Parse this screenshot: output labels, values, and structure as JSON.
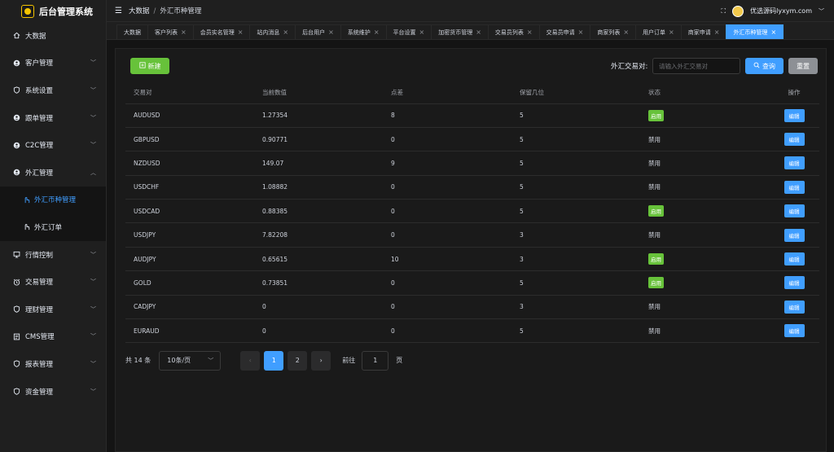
{
  "app": {
    "title": "后台管理系统"
  },
  "sidebar": {
    "items": [
      {
        "label": "大数据",
        "icon": "home-icon"
      },
      {
        "label": "客户管理",
        "icon": "user-circle-icon"
      },
      {
        "label": "系统设置",
        "icon": "shield-icon"
      },
      {
        "label": "跟单管理",
        "icon": "user-circle-icon"
      },
      {
        "label": "C2C管理",
        "icon": "user-circle-icon"
      },
      {
        "label": "外汇管理",
        "icon": "user-circle-icon"
      },
      {
        "label": "外汇币种管理",
        "icon": "pointer-icon"
      },
      {
        "label": "外汇订单",
        "icon": "pointer-icon"
      },
      {
        "label": "行情控制",
        "icon": "monitor-icon"
      },
      {
        "label": "交易管理",
        "icon": "alarm-icon"
      },
      {
        "label": "理财管理",
        "icon": "shield-icon"
      },
      {
        "label": "CMS管理",
        "icon": "document-icon"
      },
      {
        "label": "报表管理",
        "icon": "shield-icon"
      },
      {
        "label": "资金管理",
        "icon": "shield-icon"
      }
    ]
  },
  "header": {
    "breadcrumb_root": "大数据",
    "breadcrumb_current": "外汇币种管理",
    "username": "优选源码lyxym.com"
  },
  "tabs": [
    {
      "label": "大数据"
    },
    {
      "label": "客户列表"
    },
    {
      "label": "会员实名管理"
    },
    {
      "label": "站内消息"
    },
    {
      "label": "后台用户"
    },
    {
      "label": "系统维护"
    },
    {
      "label": "平台设置"
    },
    {
      "label": "加密货币管理"
    },
    {
      "label": "交易员列表"
    },
    {
      "label": "交易员申请"
    },
    {
      "label": "商家列表"
    },
    {
      "label": "用户订单"
    },
    {
      "label": "商家申请"
    },
    {
      "label": "外汇币种管理"
    }
  ],
  "toolbar": {
    "new_label": "新建",
    "filter_label": "外汇交易对:",
    "filter_placeholder": "请输入外汇交易对",
    "query_label": "查询",
    "reset_label": "重置"
  },
  "table": {
    "headers": [
      "交易对",
      "当前数值",
      "点差",
      "保留几位",
      "状态",
      "操作"
    ],
    "rows": [
      {
        "pair": "AUDUSD",
        "value": "1.27354",
        "spread": "8",
        "decimals": "5",
        "status": "启用",
        "enabled": true,
        "action": "编辑"
      },
      {
        "pair": "GBPUSD",
        "value": "0.90771",
        "spread": "0",
        "decimals": "5",
        "status": "禁用",
        "enabled": false,
        "action": "编辑"
      },
      {
        "pair": "NZDUSD",
        "value": "149.07",
        "spread": "9",
        "decimals": "5",
        "status": "禁用",
        "enabled": false,
        "action": "编辑"
      },
      {
        "pair": "USDCHF",
        "value": "1.08882",
        "spread": "0",
        "decimals": "5",
        "status": "禁用",
        "enabled": false,
        "action": "编辑"
      },
      {
        "pair": "USDCAD",
        "value": "0.88385",
        "spread": "0",
        "decimals": "5",
        "status": "启用",
        "enabled": true,
        "action": "编辑"
      },
      {
        "pair": "USDJPY",
        "value": "7.82208",
        "spread": "0",
        "decimals": "3",
        "status": "禁用",
        "enabled": false,
        "action": "编辑"
      },
      {
        "pair": "AUDJPY",
        "value": "0.65615",
        "spread": "10",
        "decimals": "3",
        "status": "启用",
        "enabled": true,
        "action": "编辑"
      },
      {
        "pair": "GOLD",
        "value": "0.73851",
        "spread": "0",
        "decimals": "5",
        "status": "启用",
        "enabled": true,
        "action": "编辑"
      },
      {
        "pair": "CADJPY",
        "value": "0",
        "spread": "0",
        "decimals": "3",
        "status": "禁用",
        "enabled": false,
        "action": "编辑"
      },
      {
        "pair": "EURAUD",
        "value": "0",
        "spread": "0",
        "decimals": "5",
        "status": "禁用",
        "enabled": false,
        "action": "编辑"
      }
    ]
  },
  "pagination": {
    "total_text": "共 14 条",
    "page_size": "10条/页",
    "pages": [
      "1",
      "2"
    ],
    "current_page": "1",
    "prev": "‹",
    "next": "›",
    "goto_label": "前往",
    "goto_value": "1",
    "goto_unit": "页"
  },
  "colors": {
    "accent": "#409eff",
    "success": "#67c23a",
    "bg": "#141414",
    "panel": "#1f1f1f"
  }
}
